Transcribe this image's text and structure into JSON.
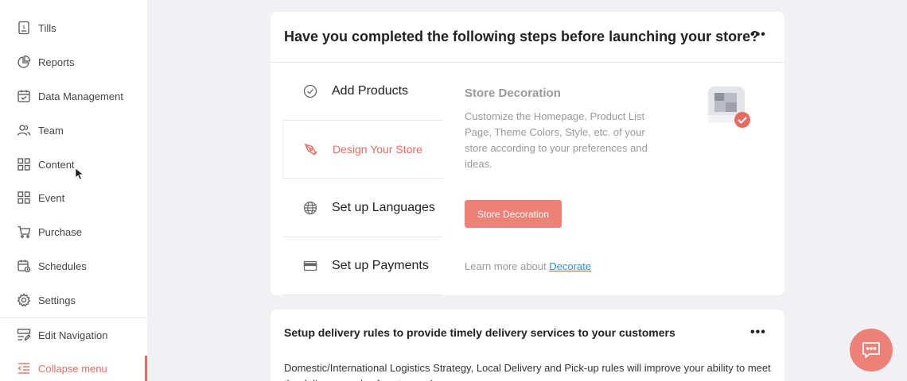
{
  "sidebar": {
    "items": [
      {
        "label": "Tills",
        "icon": "till-icon"
      },
      {
        "label": "Reports",
        "icon": "pie-chart-icon"
      },
      {
        "label": "Data Management",
        "icon": "calendar-check-icon"
      },
      {
        "label": "Team",
        "icon": "team-icon"
      },
      {
        "label": "Content",
        "icon": "grid-icon"
      },
      {
        "label": "Event",
        "icon": "grid-icon"
      },
      {
        "label": "Purchase",
        "icon": "cart-icon"
      },
      {
        "label": "Schedules",
        "icon": "schedule-icon"
      },
      {
        "label": "Settings",
        "icon": "gear-icon"
      }
    ],
    "edit_navigation": "Edit Navigation",
    "collapse_menu": "Collapse menu"
  },
  "launch_card": {
    "title": "Have you completed the following steps before launching your store?",
    "more": "•••",
    "steps": [
      {
        "label": "Add Products",
        "icon": "check-circle-icon",
        "active": false
      },
      {
        "label": "Design Your Store",
        "icon": "pen-icon",
        "active": true
      },
      {
        "label": "Set up Languages",
        "icon": "globe-icon",
        "active": false
      },
      {
        "label": "Set up Payments",
        "icon": "credit-card-icon",
        "active": false
      }
    ],
    "detail": {
      "title": "Store Decoration",
      "description": "Customize the Homepage, Product List Page, Theme Colors, Style, etc. of your store according to your preferences and ideas.",
      "button_label": "Store Decoration",
      "learn_more_prefix": "Learn more about",
      "learn_more_link": "Decorate"
    }
  },
  "delivery_card": {
    "title": "Setup delivery rules to provide timely delivery services to your customers",
    "more": "•••",
    "description": "Domestic/International Logistics Strategy, Local Delivery and Pick-up rules will improve your ability to meet the delivery needs of customers!"
  },
  "colors": {
    "accent": "#ee8177",
    "active_text": "#e86a60",
    "link": "#2b8de6",
    "background": "#f0f1f4"
  }
}
